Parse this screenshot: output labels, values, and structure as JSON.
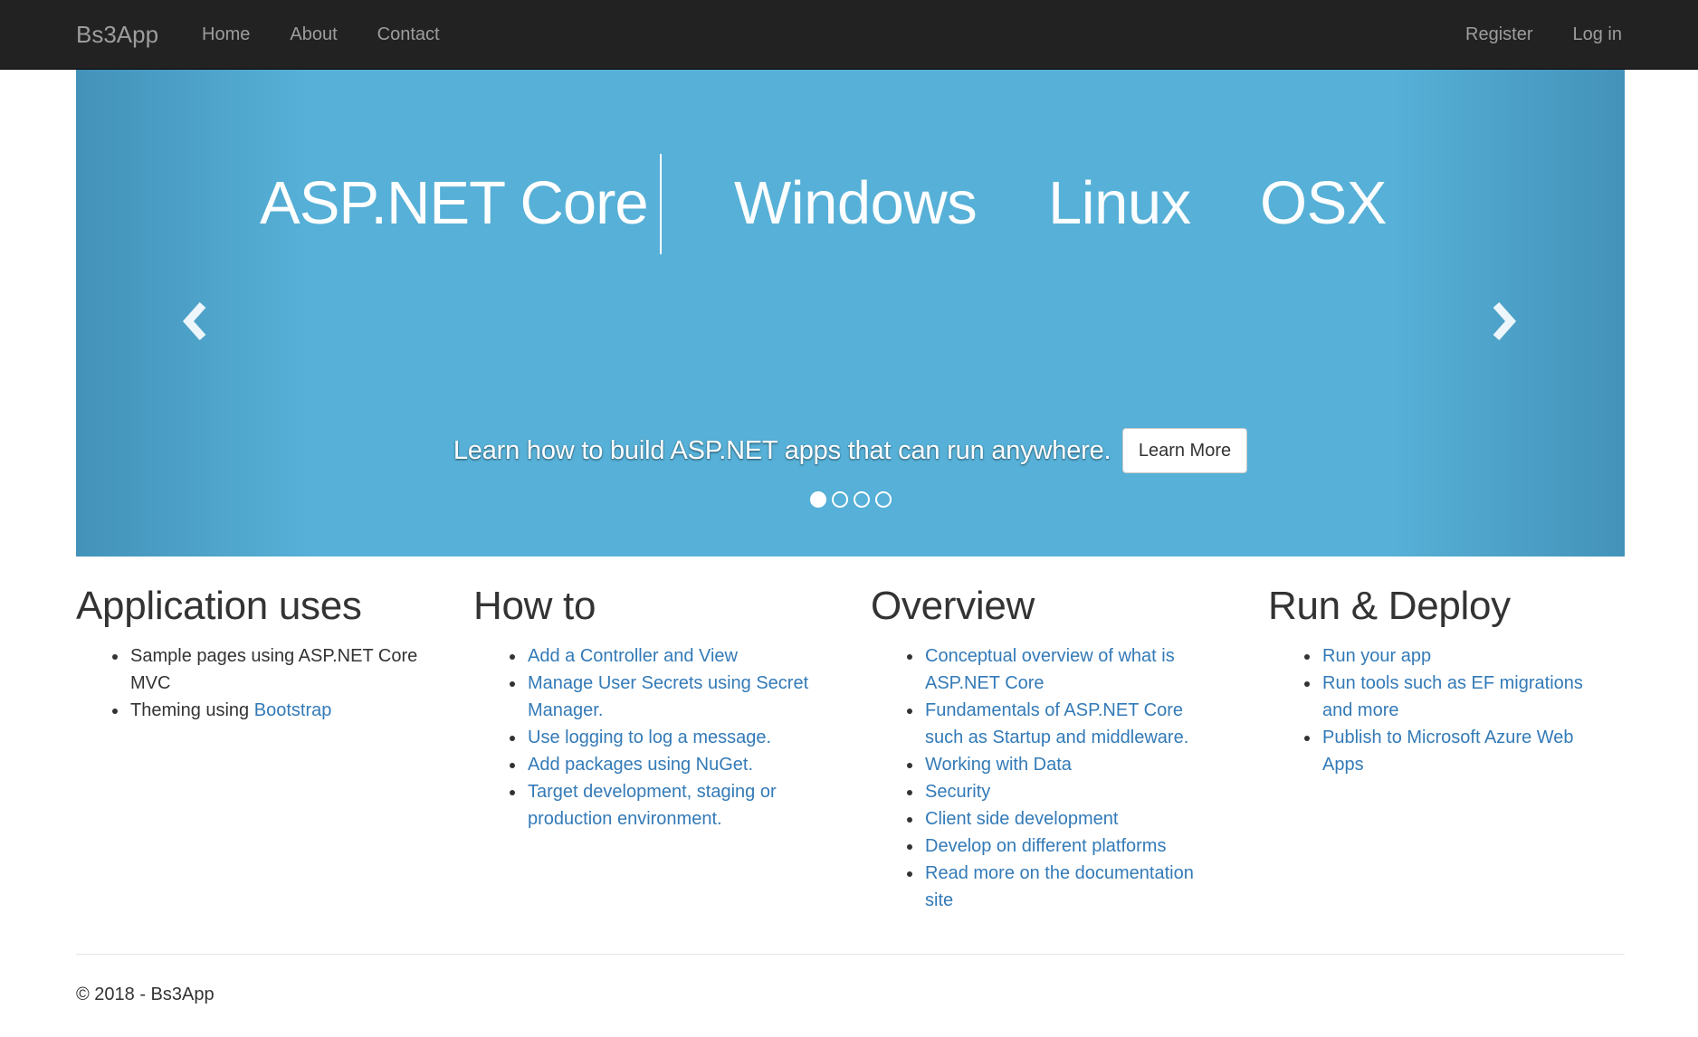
{
  "navbar": {
    "brand": "Bs3App",
    "left_links": [
      "Home",
      "About",
      "Contact"
    ],
    "right_links": [
      "Register",
      "Log in"
    ]
  },
  "carousel": {
    "hero_title": "ASP.NET Core",
    "hero_platforms": [
      "Windows",
      "Linux",
      "OSX"
    ],
    "caption": "Learn how to build ASP.NET apps that can run anywhere.",
    "button_label": "Learn More",
    "slide_count": 4,
    "active_slide": 1,
    "background_color": "#56b0d7"
  },
  "columns": [
    {
      "heading": "Application uses",
      "items": [
        {
          "text": "Sample pages using ASP.NET Core MVC"
        },
        {
          "text": "Theming using ",
          "link": "Bootstrap"
        }
      ]
    },
    {
      "heading": "How to",
      "items": [
        {
          "link": "Add a Controller and View"
        },
        {
          "link": "Manage User Secrets using Secret Manager."
        },
        {
          "link": "Use logging to log a message."
        },
        {
          "link": "Add packages using NuGet."
        },
        {
          "link": "Target development, staging or production environment."
        }
      ]
    },
    {
      "heading": "Overview",
      "items": [
        {
          "link": "Conceptual overview of what is ASP.NET Core"
        },
        {
          "link": "Fundamentals of ASP.NET Core such as Startup and middleware."
        },
        {
          "link": "Working with Data"
        },
        {
          "link": "Security"
        },
        {
          "link": "Client side development"
        },
        {
          "link": "Develop on different platforms"
        },
        {
          "link": "Read more on the documentation site"
        }
      ]
    },
    {
      "heading": "Run & Deploy",
      "items": [
        {
          "link": "Run your app"
        },
        {
          "link": "Run tools such as EF migrations and more"
        },
        {
          "link": "Publish to Microsoft Azure Web Apps"
        }
      ]
    }
  ],
  "footer": {
    "text": "© 2018 - Bs3App"
  },
  "colors": {
    "navbar": "#222222",
    "nav_text": "#9d9d9d",
    "link": "#337ab7"
  }
}
